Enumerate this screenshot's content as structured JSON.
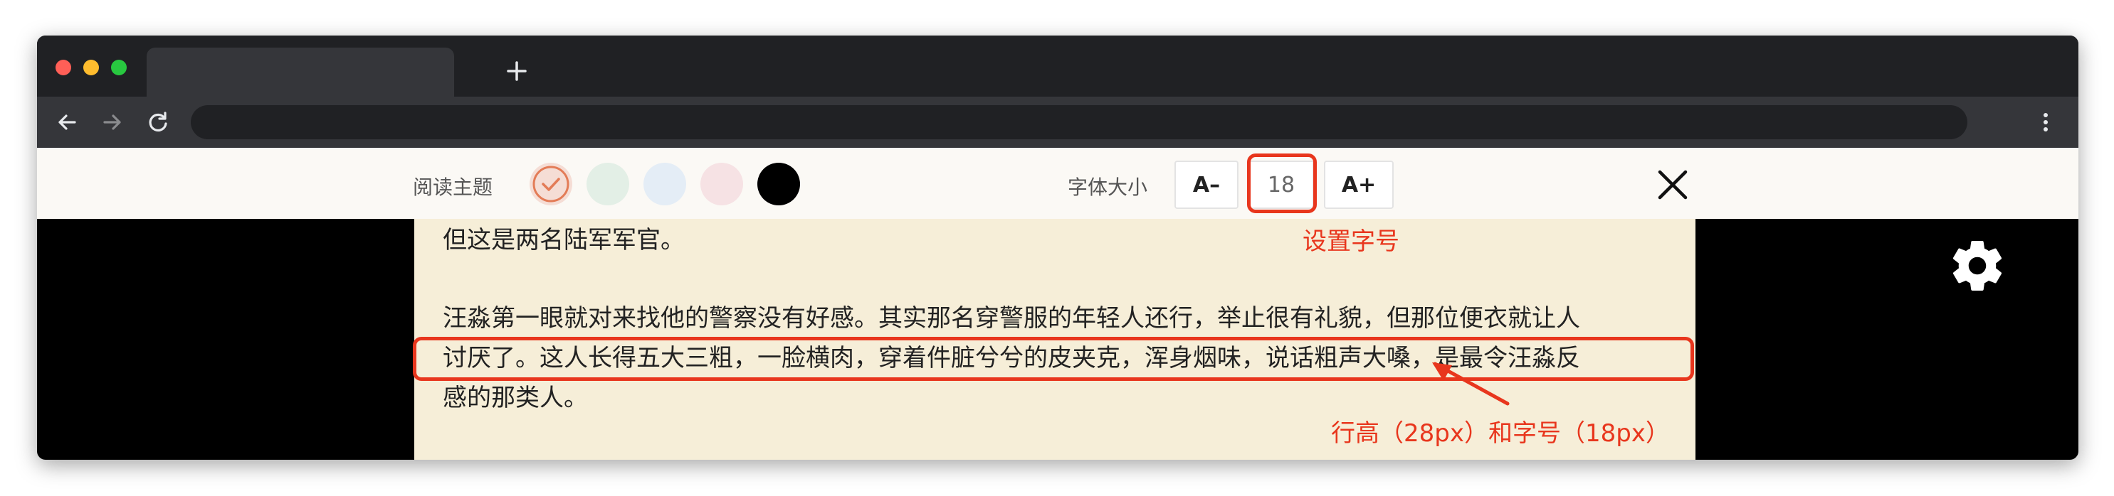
{
  "reader": {
    "theme_label": "阅读主题",
    "theme_swatches": [
      {
        "name": "theme-warm",
        "color": "#f5ddd5",
        "selected": true
      },
      {
        "name": "theme-green",
        "color": "#e3efe6",
        "selected": false
      },
      {
        "name": "theme-blue",
        "color": "#e4edf6",
        "selected": false
      },
      {
        "name": "theme-pink",
        "color": "#f6e2e4",
        "selected": false
      },
      {
        "name": "theme-dark",
        "color": "#000000",
        "selected": false
      }
    ],
    "font_size_label": "字体大小",
    "decrease_label": "A–",
    "font_size_value": "18",
    "increase_label": "A+"
  },
  "article": {
    "line1": "但这是两名陆军军官。",
    "line2": "汪淼第一眼就对来找他的警察没有好感。其实那名穿警服的年轻人还行，举止很有礼貌，但那位便衣就让人",
    "line3": "讨厌了。这人长得五大三粗，一脸横肉，穿着件脏兮兮的皮夹克，浑身烟味，说话粗声大嗓，是最令汪淼反",
    "line4": "感的那类人。"
  },
  "annotations": {
    "font_size_note": "设置字号",
    "line_height_note": "行高（28px）和字号（18px）",
    "color": "#e8361d"
  }
}
